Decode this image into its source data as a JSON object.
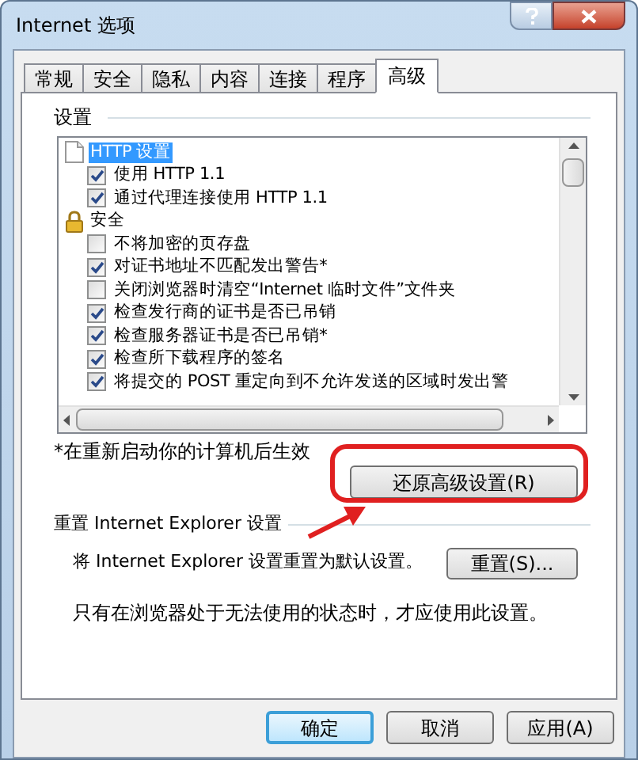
{
  "window": {
    "title": "Internet 选项"
  },
  "tabs": [
    {
      "label": "常规",
      "selected": false
    },
    {
      "label": "安全",
      "selected": false
    },
    {
      "label": "隐私",
      "selected": false
    },
    {
      "label": "内容",
      "selected": false
    },
    {
      "label": "连接",
      "selected": false
    },
    {
      "label": "程序",
      "selected": false
    },
    {
      "label": "高级",
      "selected": true
    }
  ],
  "settings": {
    "title": "设置",
    "items": [
      {
        "kind": "page",
        "label": "HTTP 设置",
        "selected": true
      },
      {
        "kind": "checkbox",
        "label": "使用 HTTP 1.1",
        "checked": true,
        "selected": false
      },
      {
        "kind": "checkbox",
        "label": "通过代理连接使用 HTTP 1.1",
        "checked": true,
        "selected": false
      },
      {
        "kind": "lock",
        "label": "安全",
        "selected": false
      },
      {
        "kind": "checkbox",
        "label": "不将加密的页存盘",
        "checked": false,
        "selected": false
      },
      {
        "kind": "checkbox",
        "label": "对证书地址不匹配发出警告*",
        "checked": true,
        "selected": false
      },
      {
        "kind": "checkbox",
        "label": "关闭浏览器时清空“Internet 临时文件”文件夹",
        "checked": false,
        "selected": false
      },
      {
        "kind": "checkbox",
        "label": "检查发行商的证书是否已吊销",
        "checked": true,
        "selected": false
      },
      {
        "kind": "checkbox",
        "label": "检查服务器证书是否已吊销*",
        "checked": true,
        "selected": false
      },
      {
        "kind": "checkbox",
        "label": "检查所下载程序的签名",
        "checked": true,
        "selected": false
      },
      {
        "kind": "checkbox",
        "label": "将提交的 POST 重定向到不允许发送的区域时发出警",
        "checked": true,
        "selected": false
      }
    ],
    "note": "*在重新启动你的计算机后生效",
    "restore_button": "还原高级设置(R)"
  },
  "reset": {
    "title": "重置 Internet Explorer 设置",
    "description": "将 Internet Explorer 设置重置为默认设置。",
    "button": "重置(S)...",
    "note": "只有在浏览器处于无法使用的状态时，才应使用此设置。"
  },
  "buttons": [
    {
      "label": "确定",
      "default": true
    },
    {
      "label": "取消",
      "default": false
    },
    {
      "label": "应用(A)",
      "default": false
    }
  ]
}
